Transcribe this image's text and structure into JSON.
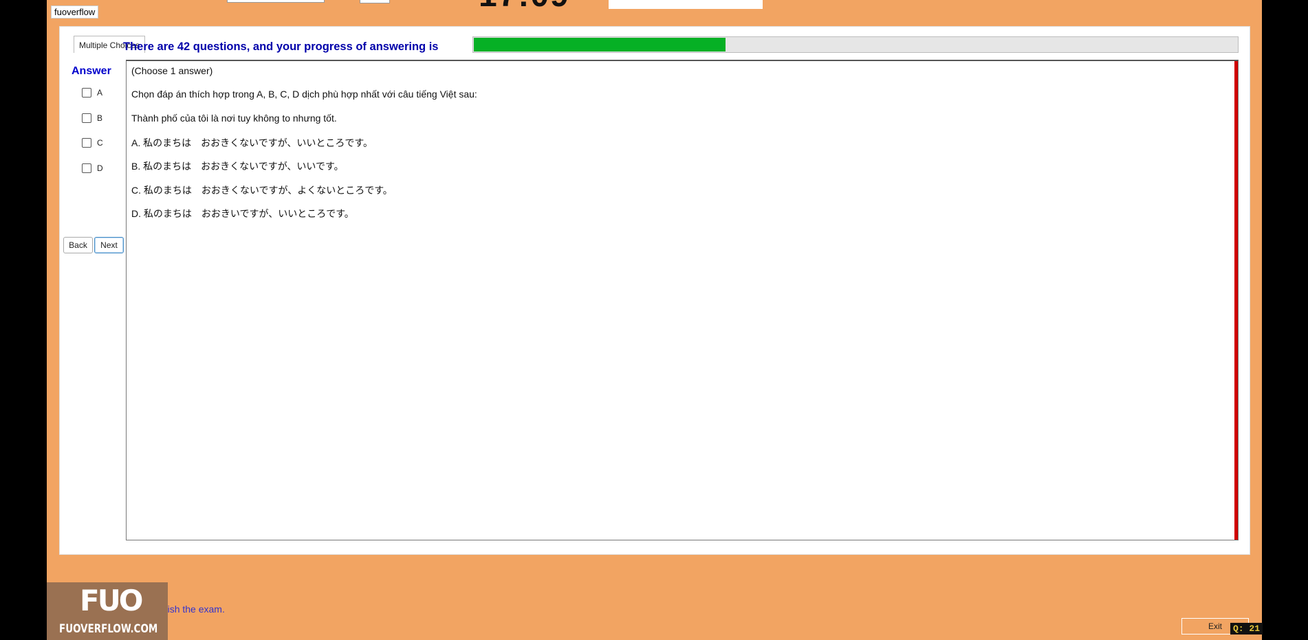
{
  "header": {
    "timer_partial": "17:09",
    "watermark": "fuoverflow"
  },
  "tab": {
    "label": "Multiple Choices"
  },
  "progress": {
    "label": "There are 42 questions, and your progress of answering is",
    "fraction": 0.33
  },
  "answer": {
    "heading": "Answer",
    "options": [
      "A",
      "B",
      "C",
      "D"
    ]
  },
  "nav": {
    "back": "Back",
    "next": "Next"
  },
  "question": {
    "lines": [
      "(Choose 1 answer)",
      "Chọn đáp án thích hợp trong A, B, C, D dịch phù hợp nhất với câu tiếng Việt sau:",
      "Thành phố của tôi là nơi tuy không to nhưng tốt.",
      "A.  私のまちは　おおきくないですが、いいところです。",
      "B.  私のまちは　おおきくないですが、いいです。",
      "C.  私のまちは　おおきくないですが、よくないところです。",
      "D.  私のまちは　おおきいですが、いいところです。"
    ]
  },
  "footer": {
    "finish_text": "I want to finish the exam.",
    "logo_text": "FUO",
    "logo_domain": "FUOVERFLOW.COM",
    "exit": "Exit",
    "question_counter": "Q: 21"
  },
  "colors": {
    "background": "#F2A462",
    "progress_fill": "#06B025",
    "accent_blue": "#0000AA",
    "scroll_marker": "#D00000"
  }
}
